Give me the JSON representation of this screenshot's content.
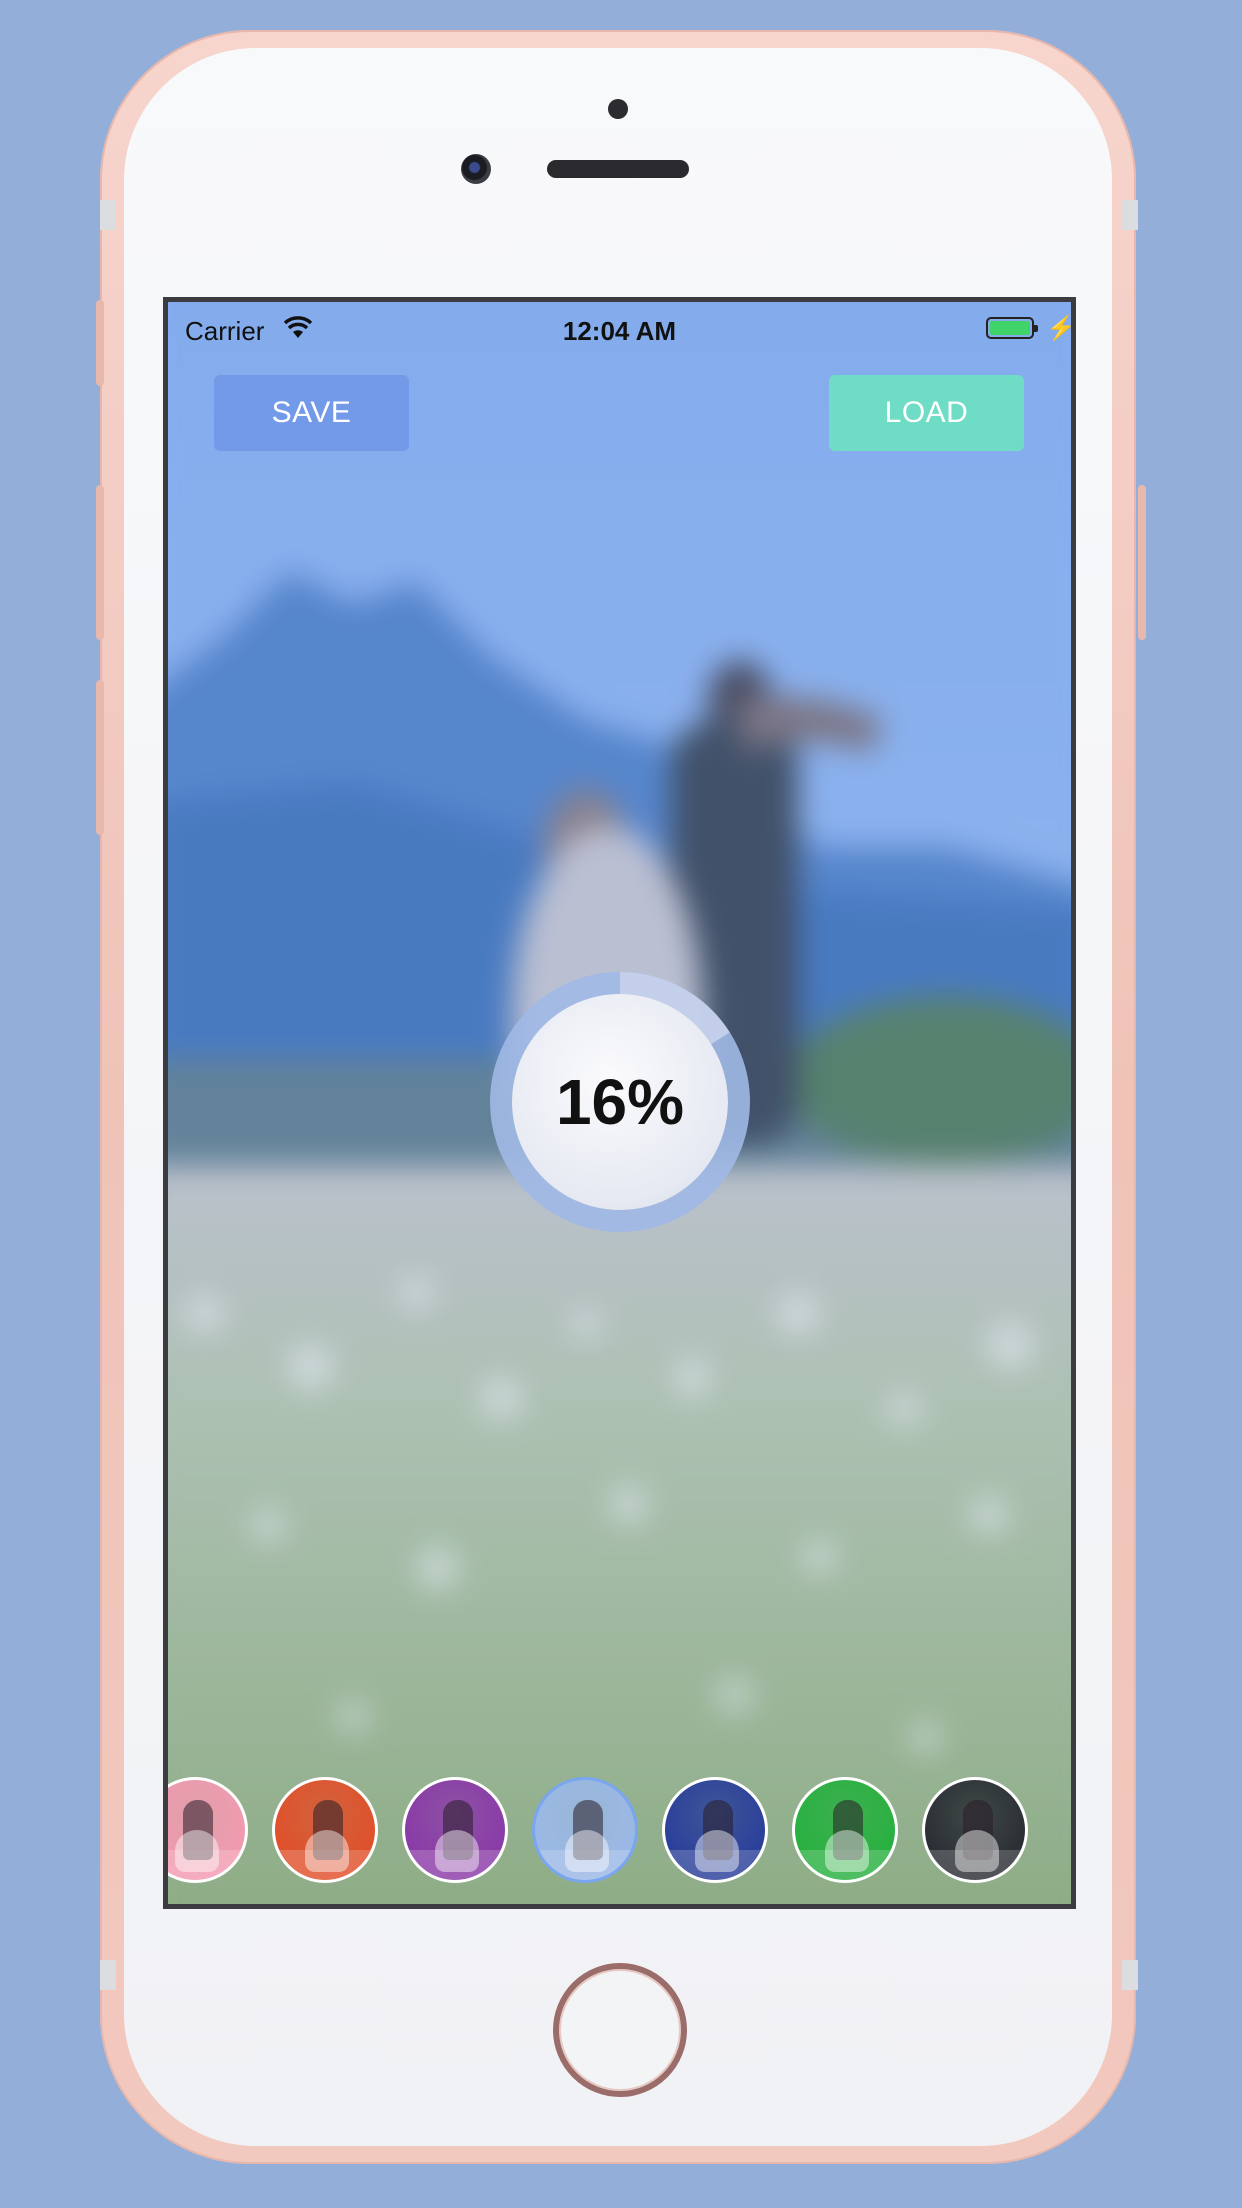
{
  "status_bar": {
    "carrier": "Carrier",
    "time": "12:04 AM",
    "wifi_icon": "wifi-icon",
    "battery_icon": "battery-icon",
    "charging_icon": "charging-bolt-icon"
  },
  "toolbar": {
    "save_label": "SAVE",
    "load_label": "LOAD"
  },
  "progress": {
    "label": "16%",
    "fraction": 0.16
  },
  "filters": [
    {
      "name": "pink",
      "tint": "#f29ab0",
      "selected": false
    },
    {
      "name": "red",
      "tint": "#e0502a",
      "selected": false
    },
    {
      "name": "purple",
      "tint": "#8a3aa8",
      "selected": false
    },
    {
      "name": "original",
      "tint": "#9ab8e6",
      "selected": true
    },
    {
      "name": "blue",
      "tint": "#2a3f9a",
      "selected": false
    },
    {
      "name": "green",
      "tint": "#28b040",
      "selected": false
    },
    {
      "name": "dark",
      "tint": "#2a2e34",
      "selected": false
    }
  ],
  "colors": {
    "background": "#92aed9",
    "save_button": "#7096e6",
    "load_button": "#6fdcc5",
    "phone_body": "#f2c9bf"
  }
}
